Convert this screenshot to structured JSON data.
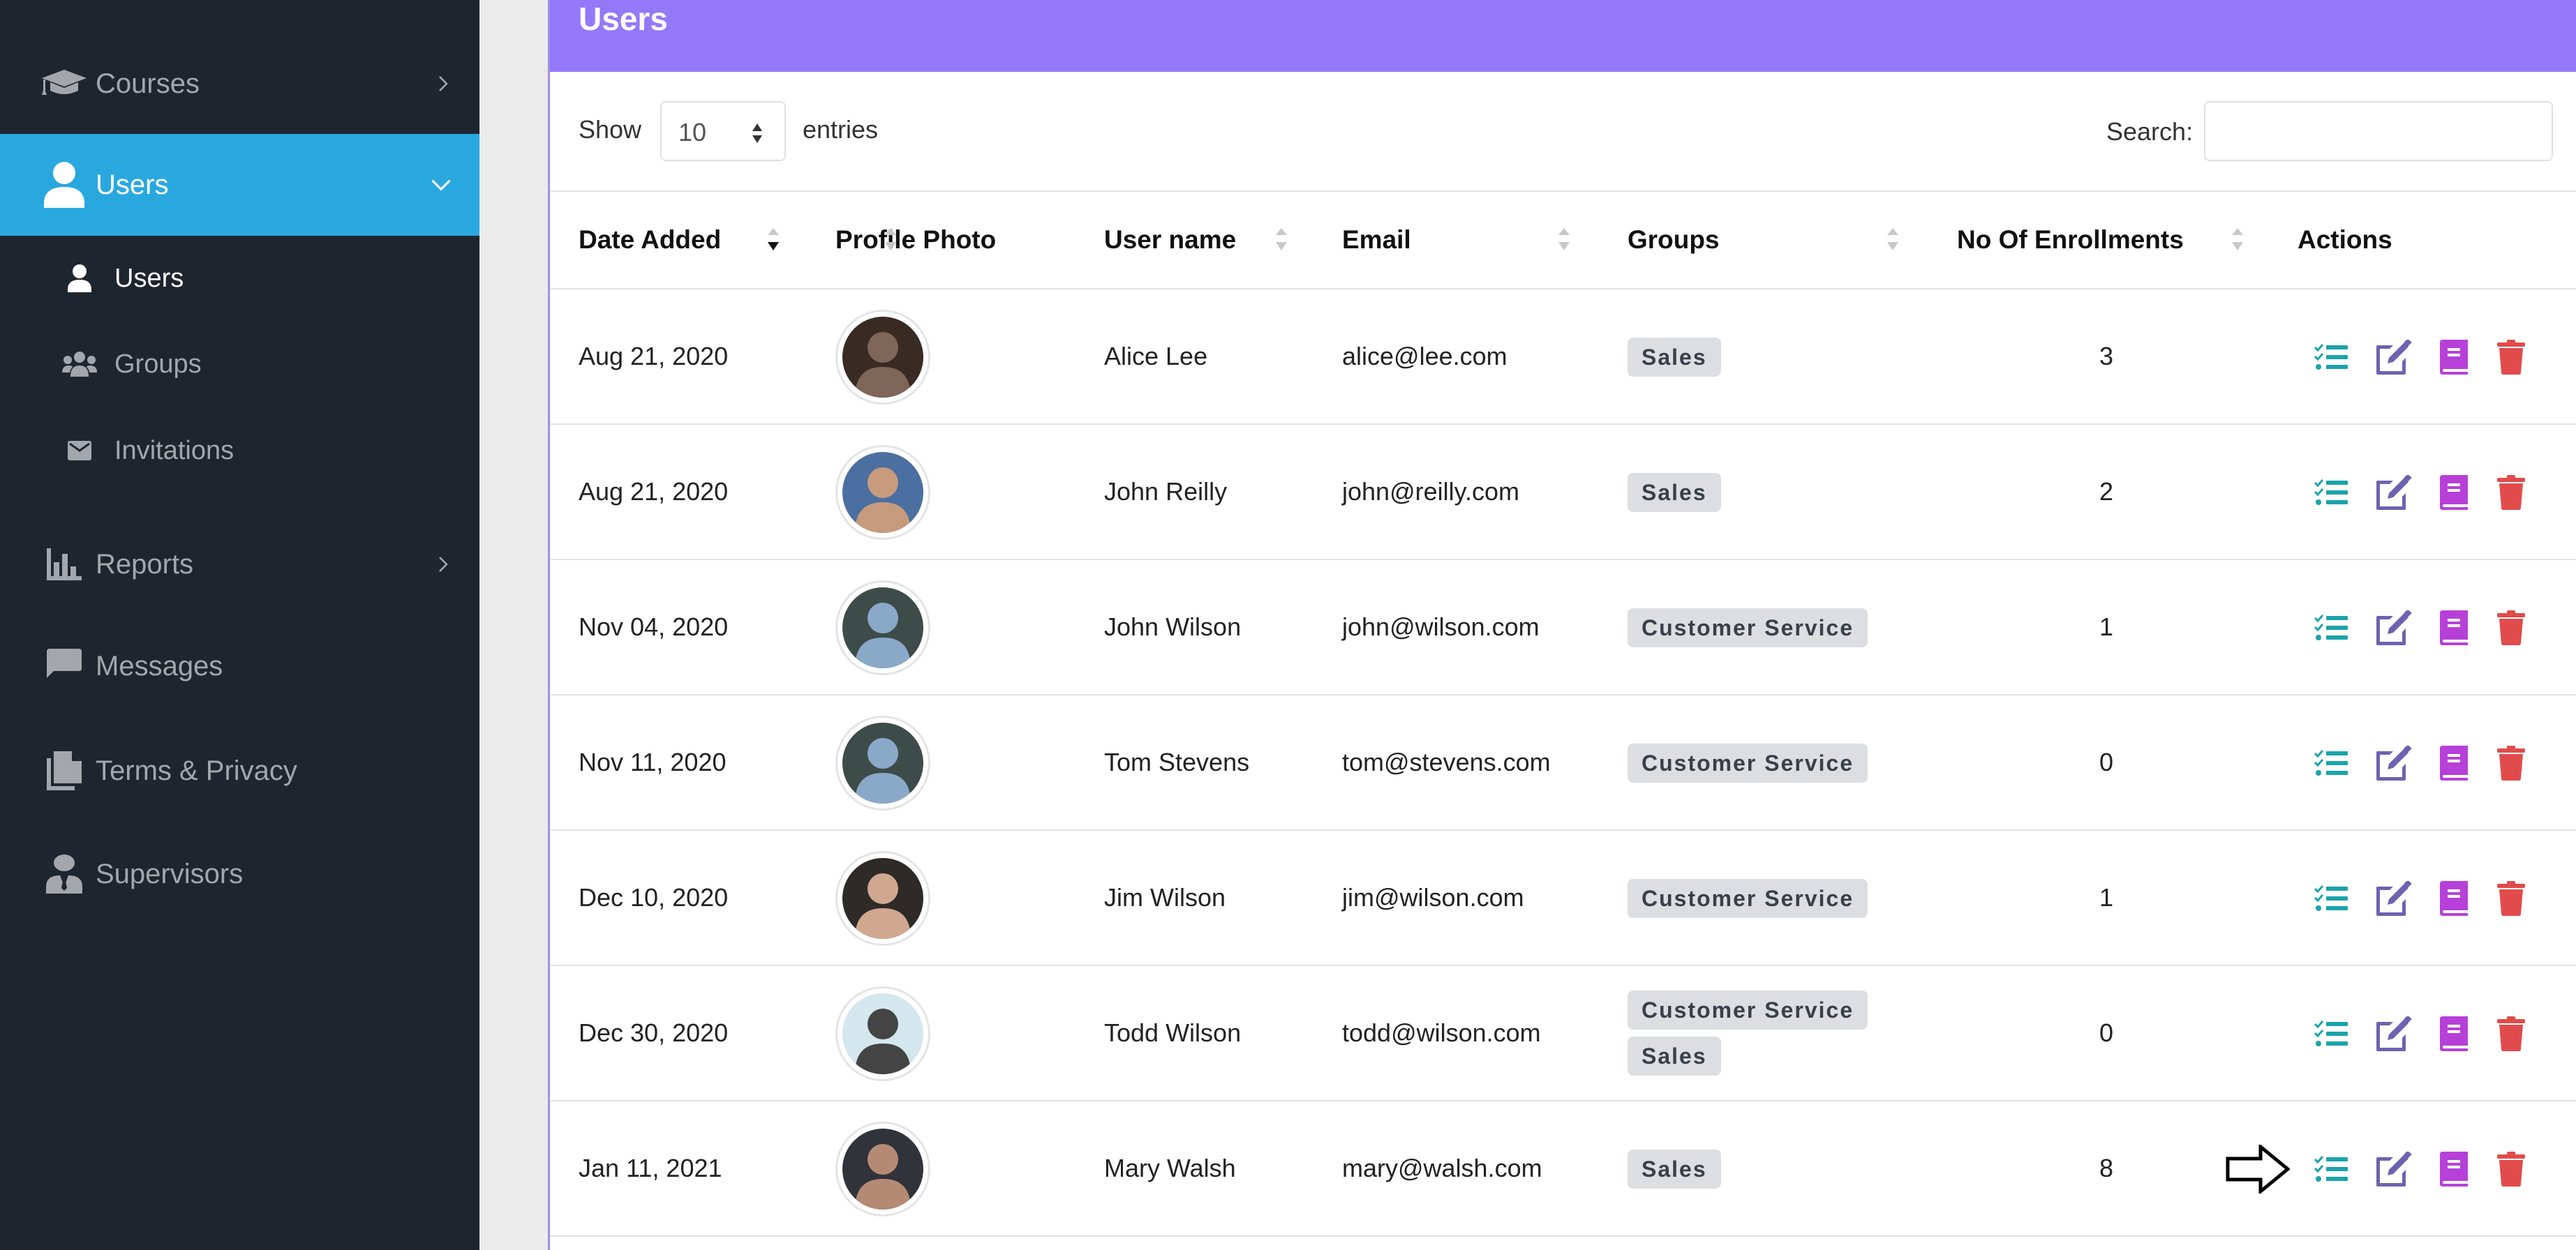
{
  "sidebar": {
    "items": [
      {
        "label": "Courses",
        "icon": "graduation-cap-icon",
        "chevron": "right"
      },
      {
        "label": "Users",
        "icon": "user-icon",
        "chevron": "down",
        "active": true
      },
      {
        "label": "Reports",
        "icon": "bar-chart-icon",
        "chevron": "right"
      },
      {
        "label": "Messages",
        "icon": "message-icon"
      },
      {
        "label": "Terms & Privacy",
        "icon": "document-icon"
      },
      {
        "label": "Supervisors",
        "icon": "supervisor-icon"
      }
    ],
    "subitems": [
      {
        "label": "Users",
        "icon": "user-icon",
        "current": true
      },
      {
        "label": "Groups",
        "icon": "users-group-icon"
      },
      {
        "label": "Invitations",
        "icon": "envelope-icon"
      }
    ]
  },
  "card": {
    "title": "Users",
    "show_label": "Show",
    "page_length": "10",
    "entries_label": "entries",
    "search_label": "Search:",
    "search_value": "",
    "header_color": "#9379f9"
  },
  "table": {
    "columns": [
      "Date Added",
      "Profile Photo",
      "User name",
      "Email",
      "Groups",
      "No Of Enrollments",
      "Actions"
    ],
    "sorted_column": "Date Added",
    "sort_direction": "desc",
    "rows": [
      {
        "date": "Aug 21, 2020",
        "name": "Alice Lee",
        "email": "alice@lee.com",
        "groups": [
          "Sales"
        ],
        "enrollments": "3"
      },
      {
        "date": "Aug 21, 2020",
        "name": "John Reilly",
        "email": "john@reilly.com",
        "groups": [
          "Sales"
        ],
        "enrollments": "2"
      },
      {
        "date": "Nov 04, 2020",
        "name": "John Wilson",
        "email": "john@wilson.com",
        "groups": [
          "Customer Service"
        ],
        "enrollments": "1"
      },
      {
        "date": "Nov 11, 2020",
        "name": "Tom Stevens",
        "email": "tom@stevens.com",
        "groups": [
          "Customer Service"
        ],
        "enrollments": "0"
      },
      {
        "date": "Dec 10, 2020",
        "name": "Jim Wilson",
        "email": "jim@wilson.com",
        "groups": [
          "Customer Service"
        ],
        "enrollments": "1"
      },
      {
        "date": "Dec 30, 2020",
        "name": "Todd Wilson",
        "email": "todd@wilson.com",
        "groups": [
          "Customer Service",
          "Sales"
        ],
        "enrollments": "0"
      },
      {
        "date": "Jan 11, 2021",
        "name": "Mary Walsh",
        "email": "mary@walsh.com",
        "groups": [
          "Sales"
        ],
        "enrollments": "8"
      }
    ],
    "actions": [
      {
        "name": "enrollments-list",
        "icon": "checklist-icon",
        "color": "#1aa3ab"
      },
      {
        "name": "edit",
        "icon": "edit-icon",
        "color": "#6c63b0"
      },
      {
        "name": "courses",
        "icon": "book-icon",
        "color": "#b640d8"
      },
      {
        "name": "delete",
        "icon": "trash-icon",
        "color": "#e24b4b"
      }
    ],
    "pointer_row": 6
  },
  "colors": {
    "sidebar_bg": "#1f252e",
    "active_nav": "#29a8e0"
  }
}
